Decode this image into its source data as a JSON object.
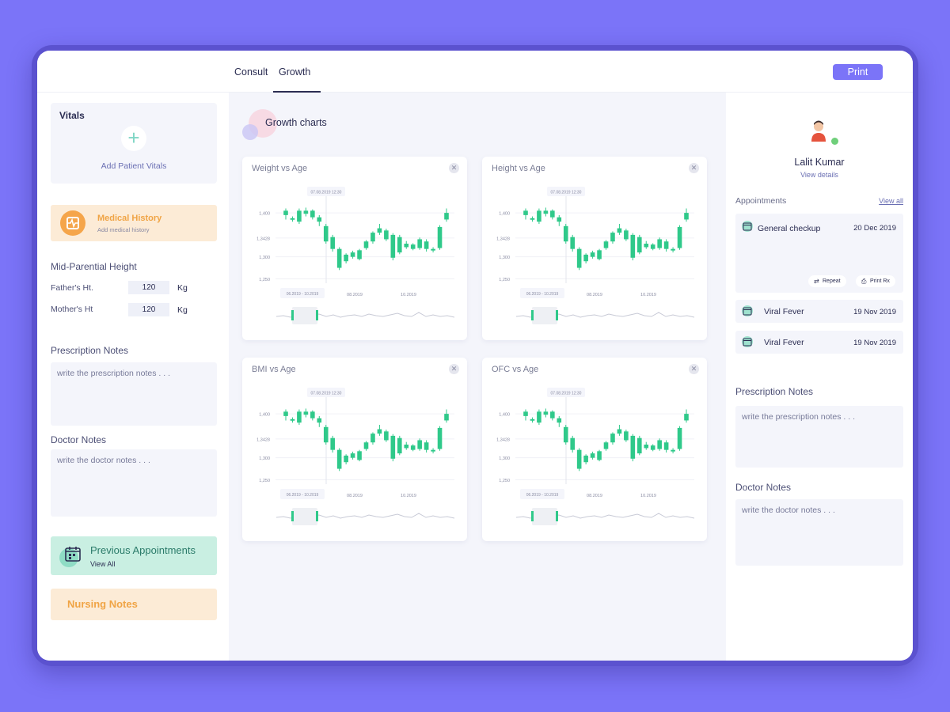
{
  "tabs": [
    {
      "label": "Consult",
      "active": false
    },
    {
      "label": "Growth",
      "active": true
    }
  ],
  "print_label": "Print",
  "left": {
    "vitals_title": "Vitals",
    "add_vitals": "Add Patient Vitals",
    "medical_history": {
      "title": "Medical History",
      "sub": "Add medical history"
    },
    "mid_parental_title": "Mid-Parential Height",
    "father": {
      "label": "Father's Ht.",
      "value": "120",
      "unit": "Kg"
    },
    "mother": {
      "label": "Mother's Ht",
      "value": "120",
      "unit": "Kg"
    },
    "prescription_title": "Prescription Notes",
    "prescription_placeholder": "write the prescription notes . . .",
    "doctor_title": "Doctor Notes",
    "doctor_placeholder": "write the doctor notes . . .",
    "previous_appointments": {
      "title": "Previous Appointments",
      "sub": "View All"
    },
    "nursing_notes": "Nursing Notes"
  },
  "center": {
    "title": "Growth charts",
    "charts": [
      {
        "title": "Weight vs Age"
      },
      {
        "title": "Height vs Age"
      },
      {
        "title": "BMI vs Age"
      },
      {
        "title": "OFC vs Age"
      }
    ]
  },
  "chart_data": {
    "type": "candlestick",
    "y_ticks": [
      "1,400",
      "1,3428",
      "1,300",
      "1,250"
    ],
    "x_ticks": [
      "08.2019",
      "10.2019"
    ],
    "tooltip": "07.08.2019 12:30",
    "range_label": "06.2019 - 10.2019",
    "candles": [
      {
        "o": 1395,
        "c": 1405,
        "h": 1410,
        "l": 1385
      },
      {
        "o": 1388,
        "c": 1385,
        "h": 1392,
        "l": 1380
      },
      {
        "o": 1380,
        "c": 1405,
        "h": 1410,
        "l": 1375
      },
      {
        "o": 1405,
        "c": 1398,
        "h": 1412,
        "l": 1392
      },
      {
        "o": 1390,
        "c": 1405,
        "h": 1408,
        "l": 1385
      },
      {
        "o": 1380,
        "c": 1390,
        "h": 1395,
        "l": 1370
      },
      {
        "o": 1370,
        "c": 1335,
        "h": 1375,
        "l": 1330
      },
      {
        "o": 1345,
        "c": 1318,
        "h": 1350,
        "l": 1312
      },
      {
        "o": 1318,
        "c": 1275,
        "h": 1322,
        "l": 1270
      },
      {
        "o": 1290,
        "c": 1305,
        "h": 1308,
        "l": 1285
      },
      {
        "o": 1300,
        "c": 1310,
        "h": 1314,
        "l": 1296
      },
      {
        "o": 1295,
        "c": 1315,
        "h": 1318,
        "l": 1292
      },
      {
        "o": 1320,
        "c": 1335,
        "h": 1338,
        "l": 1316
      },
      {
        "o": 1335,
        "c": 1355,
        "h": 1358,
        "l": 1330
      },
      {
        "o": 1355,
        "c": 1365,
        "h": 1375,
        "l": 1350
      },
      {
        "o": 1360,
        "c": 1340,
        "h": 1364,
        "l": 1336
      },
      {
        "o": 1350,
        "c": 1298,
        "h": 1354,
        "l": 1292
      },
      {
        "o": 1310,
        "c": 1345,
        "h": 1350,
        "l": 1306
      },
      {
        "o": 1330,
        "c": 1322,
        "h": 1336,
        "l": 1318
      },
      {
        "o": 1318,
        "c": 1328,
        "h": 1331,
        "l": 1315
      },
      {
        "o": 1320,
        "c": 1340,
        "h": 1344,
        "l": 1316
      },
      {
        "o": 1335,
        "c": 1318,
        "h": 1340,
        "l": 1312
      },
      {
        "o": 1315,
        "c": 1318,
        "h": 1322,
        "l": 1310
      },
      {
        "o": 1320,
        "c": 1368,
        "h": 1372,
        "l": 1316
      },
      {
        "o": 1385,
        "c": 1400,
        "h": 1410,
        "l": 1380
      }
    ]
  },
  "right": {
    "patient_name": "Lalit Kumar",
    "view_details": "View details",
    "appointments_label": "Appointments",
    "view_all": "View all",
    "appointments": [
      {
        "name": "General checkup",
        "date": "20 Dec 2019"
      },
      {
        "name": "Viral Fever",
        "date": "19 Nov 2019"
      },
      {
        "name": "Viral Fever",
        "date": "19 Nov 2019"
      }
    ],
    "repeat_label": "Repeat",
    "print_rx_label": "Print Rx",
    "prescription_title": "Prescription Notes",
    "prescription_placeholder": "write the prescription notes . . .",
    "doctor_title": "Doctor Notes",
    "doctor_placeholder": "write the doctor notes . . ."
  },
  "colors": {
    "accent": "#7b74f8",
    "candle": "#2fc98a",
    "medical_history": "#f0a445",
    "previous_appointments": "#2b7b6a"
  }
}
